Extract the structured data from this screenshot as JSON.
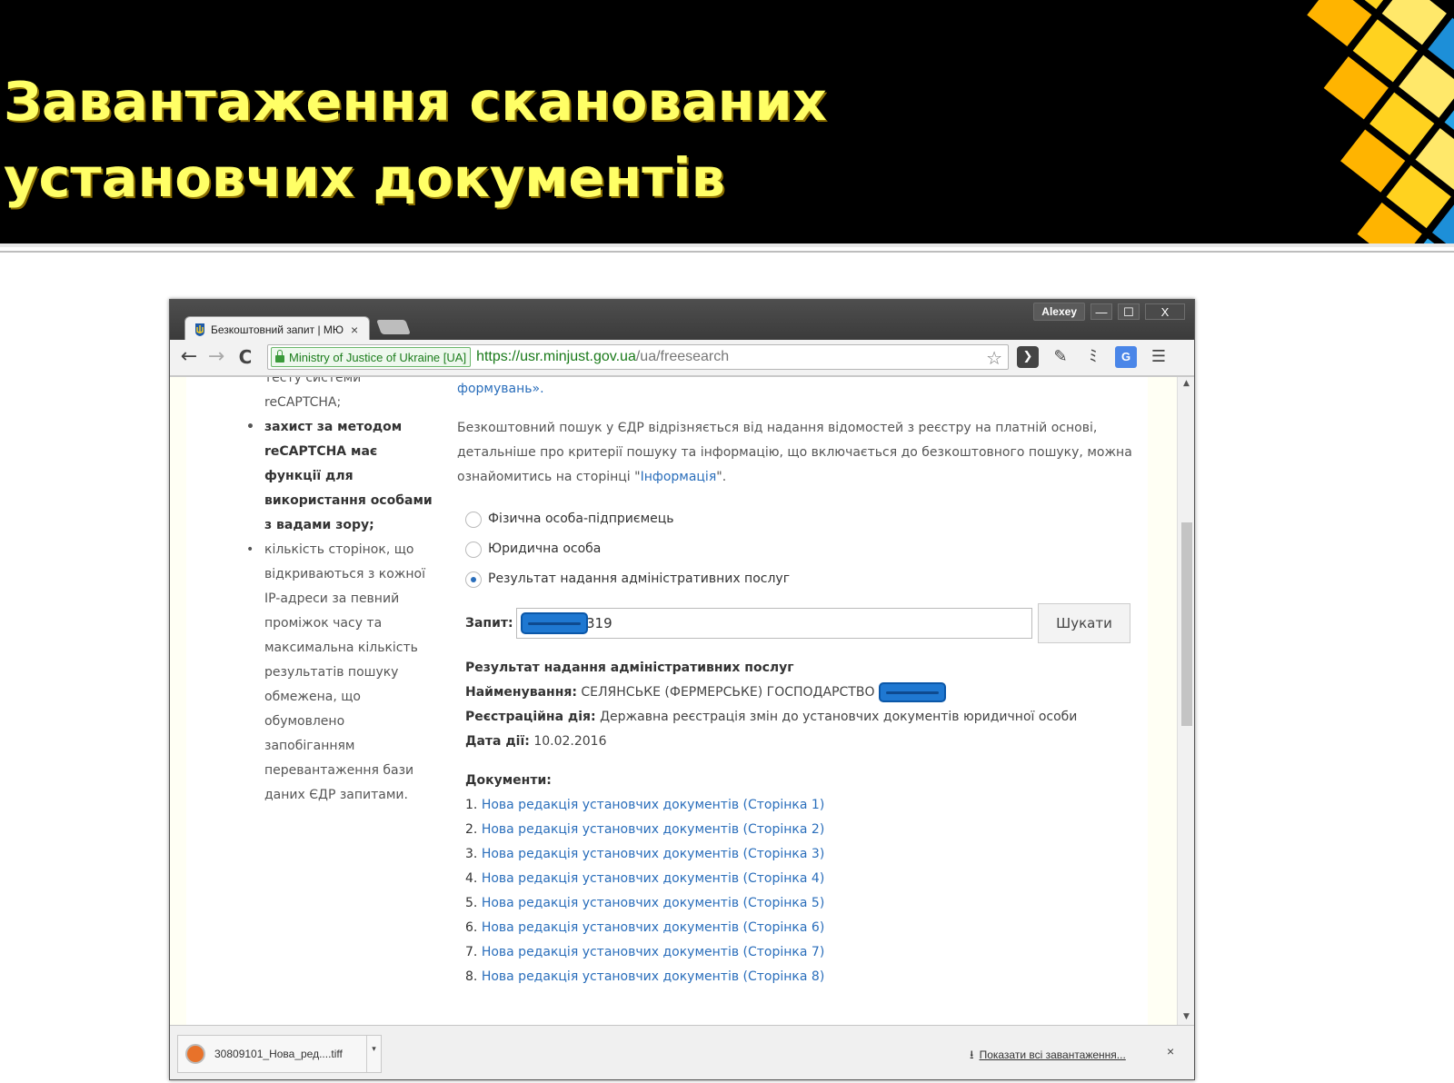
{
  "slide": {
    "title": "Завантаження сканованих установчих документів"
  },
  "window": {
    "user": "Alexey",
    "minimize": "—",
    "maximize": "☐",
    "close": "X"
  },
  "tab": {
    "title": "Безкоштовний запит | МЮ",
    "close": "×"
  },
  "toolbar": {
    "back": "←",
    "forward": "→",
    "reload": "C",
    "ev_label": "Ministry of Justice of Ukraine [UA]",
    "url_host": "https://usr.minjust.gov.ua",
    "url_path": "/ua/freesearch"
  },
  "sidebar": {
    "cut_line": "тесту системи reCAPTCHA;",
    "items": [
      {
        "text": "захист за методом reCAPTCHA має функції для використання особами з вадами зору;",
        "bold": true
      },
      {
        "text": "кількість сторінок, що відкриваються з кожної IP-адреси за певний проміжок часу та максимальна кількість результатів пошуку обмежена, що обумовлено запобіганням перевантаження бази даних ЄДР запитами.",
        "bold": false
      }
    ]
  },
  "main": {
    "top_link": "формувань».",
    "para_a": "Безкоштовний пошук у ЄДР відрізняється від надання відомостей з реєстру на платній основі, детальніше про критерії пошуку та інформацію, що включається до безкоштовного пошуку, можна ознайомитись на сторінці \"",
    "para_link": "Інформація",
    "para_b": "\".",
    "radios": [
      {
        "label": "Фізична особа-підприємець",
        "checked": false
      },
      {
        "label": "Юридична особа",
        "checked": false
      },
      {
        "label": "Результат надання адміністративних послуг",
        "checked": true
      }
    ],
    "query_label": "Запит:",
    "query_value": "319",
    "search_button": "Шукати",
    "result_heading": "Результат надання адміністративних послуг",
    "name_label": "Найменування:",
    "name_value": "СЕЛЯНСЬКЕ (ФЕРМЕРСЬКЕ) ГОСПОДАРСТВО",
    "action_label": "Реєстраційна дія:",
    "action_value": "Державна реєстрація змін до установчих документів юридичної особи",
    "date_label": "Дата дії:",
    "date_value": "10.02.2016",
    "docs_heading": "Документи:",
    "documents": [
      {
        "num": "1.",
        "title": "Нова редакція установчих документів (Сторінка 1)"
      },
      {
        "num": "2.",
        "title": "Нова редакція установчих документів (Сторінка 2)"
      },
      {
        "num": "3.",
        "title": "Нова редакція установчих документів (Сторінка 3)"
      },
      {
        "num": "4.",
        "title": "Нова редакція установчих документів (Сторінка 4)"
      },
      {
        "num": "5.",
        "title": "Нова редакція установчих документів (Сторінка 5)"
      },
      {
        "num": "6.",
        "title": "Нова редакція установчих документів (Сторінка 6)"
      },
      {
        "num": "7.",
        "title": "Нова редакція установчих документів (Сторінка 7)"
      },
      {
        "num": "8.",
        "title": "Нова редакція установчих документів (Сторінка 8)"
      }
    ]
  },
  "downloads": {
    "file_name": "30809101_Нова_ред....tiff",
    "show_all": "Показати всі завантаження...",
    "close": "×"
  },
  "colors": {
    "title_yellow": "#ffff66",
    "link_blue": "#2a6ebb",
    "ev_green": "#1a7a1a",
    "redaction_blue": "#1f78d1"
  }
}
